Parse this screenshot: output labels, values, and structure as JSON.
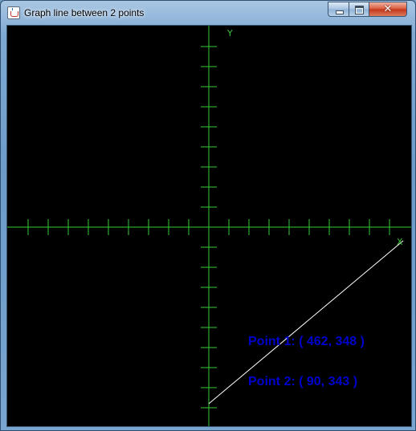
{
  "window": {
    "title": "Graph line between 2 points",
    "close_glyph": "✕"
  },
  "graph": {
    "y_label": "Y",
    "x_label": "X",
    "point1_label": "Point 1: ( 462, 348 )",
    "point2_label": "Point 2: ( 90, 343 )",
    "point1": [
      462,
      348
    ],
    "point2": [
      90,
      343
    ]
  },
  "colors": {
    "canvas_background": "#000000",
    "axis": "#33cc33",
    "line": "#ffffff",
    "label": "#0000cc"
  },
  "icons": {
    "app": "java-icon",
    "minimize": "minimize-icon",
    "maximize": "maximize-icon",
    "close": "close-icon"
  }
}
